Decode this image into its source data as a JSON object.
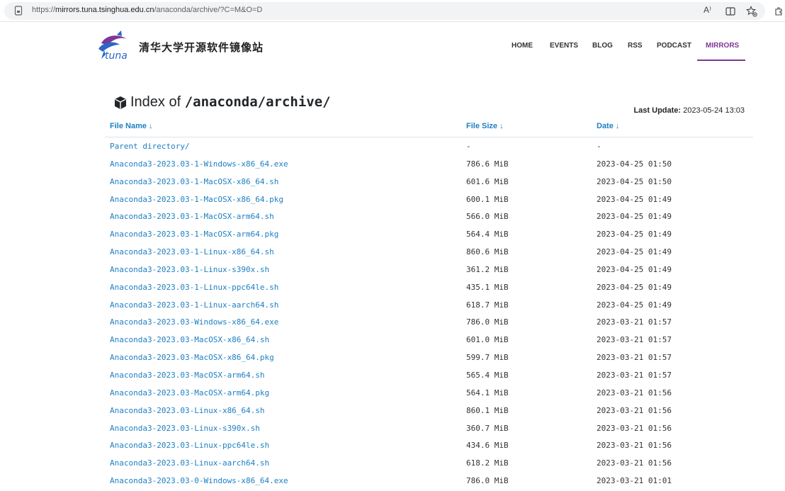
{
  "browser": {
    "url_scheme": "https://",
    "url_host": "mirrors.tuna.tsinghua.edu.cn",
    "url_path": "/anaconda/archive/?C=M&O=D",
    "reader_label": "A⁾"
  },
  "header": {
    "logo_text": "tuna",
    "brand": "清华大学开源软件镜像站",
    "nav": [
      {
        "label": "HOME"
      },
      {
        "label": "EVENTS"
      },
      {
        "label": "BLOG"
      },
      {
        "label": "RSS"
      },
      {
        "label": "PODCAST"
      },
      {
        "label": "MIRRORS",
        "active": true
      }
    ],
    "accent_color": "#7e3794"
  },
  "page": {
    "title_prefix": "Index of ",
    "title_path": "/anaconda/archive/",
    "last_update_label": "Last Update:",
    "last_update_value": "2023-05-24 13:03"
  },
  "table": {
    "headers": {
      "name": "File Name ↓",
      "size": "File Size ↓",
      "date": "Date ↓"
    },
    "link_color": "#1d7fc2",
    "rows": [
      {
        "name": "Parent directory/",
        "size": "-",
        "date": "-"
      },
      {
        "name": "Anaconda3-2023.03-1-Windows-x86_64.exe",
        "size": "786.6 MiB",
        "date": "2023-04-25 01:50"
      },
      {
        "name": "Anaconda3-2023.03-1-MacOSX-x86_64.sh",
        "size": "601.6 MiB",
        "date": "2023-04-25 01:50"
      },
      {
        "name": "Anaconda3-2023.03-1-MacOSX-x86_64.pkg",
        "size": "600.1 MiB",
        "date": "2023-04-25 01:49"
      },
      {
        "name": "Anaconda3-2023.03-1-MacOSX-arm64.sh",
        "size": "566.0 MiB",
        "date": "2023-04-25 01:49"
      },
      {
        "name": "Anaconda3-2023.03-1-MacOSX-arm64.pkg",
        "size": "564.4 MiB",
        "date": "2023-04-25 01:49"
      },
      {
        "name": "Anaconda3-2023.03-1-Linux-x86_64.sh",
        "size": "860.6 MiB",
        "date": "2023-04-25 01:49"
      },
      {
        "name": "Anaconda3-2023.03-1-Linux-s390x.sh",
        "size": "361.2 MiB",
        "date": "2023-04-25 01:49"
      },
      {
        "name": "Anaconda3-2023.03-1-Linux-ppc64le.sh",
        "size": "435.1 MiB",
        "date": "2023-04-25 01:49"
      },
      {
        "name": "Anaconda3-2023.03-1-Linux-aarch64.sh",
        "size": "618.7 MiB",
        "date": "2023-04-25 01:49"
      },
      {
        "name": "Anaconda3-2023.03-Windows-x86_64.exe",
        "size": "786.0 MiB",
        "date": "2023-03-21 01:57"
      },
      {
        "name": "Anaconda3-2023.03-MacOSX-x86_64.sh",
        "size": "601.0 MiB",
        "date": "2023-03-21 01:57"
      },
      {
        "name": "Anaconda3-2023.03-MacOSX-x86_64.pkg",
        "size": "599.7 MiB",
        "date": "2023-03-21 01:57"
      },
      {
        "name": "Anaconda3-2023.03-MacOSX-arm64.sh",
        "size": "565.4 MiB",
        "date": "2023-03-21 01:57"
      },
      {
        "name": "Anaconda3-2023.03-MacOSX-arm64.pkg",
        "size": "564.1 MiB",
        "date": "2023-03-21 01:56"
      },
      {
        "name": "Anaconda3-2023.03-Linux-x86_64.sh",
        "size": "860.1 MiB",
        "date": "2023-03-21 01:56"
      },
      {
        "name": "Anaconda3-2023.03-Linux-s390x.sh",
        "size": "360.7 MiB",
        "date": "2023-03-21 01:56"
      },
      {
        "name": "Anaconda3-2023.03-Linux-ppc64le.sh",
        "size": "434.6 MiB",
        "date": "2023-03-21 01:56"
      },
      {
        "name": "Anaconda3-2023.03-Linux-aarch64.sh",
        "size": "618.2 MiB",
        "date": "2023-03-21 01:56"
      },
      {
        "name": "Anaconda3-2023.03-0-Windows-x86_64.exe",
        "size": "786.0 MiB",
        "date": "2023-03-21 01:01"
      }
    ]
  }
}
